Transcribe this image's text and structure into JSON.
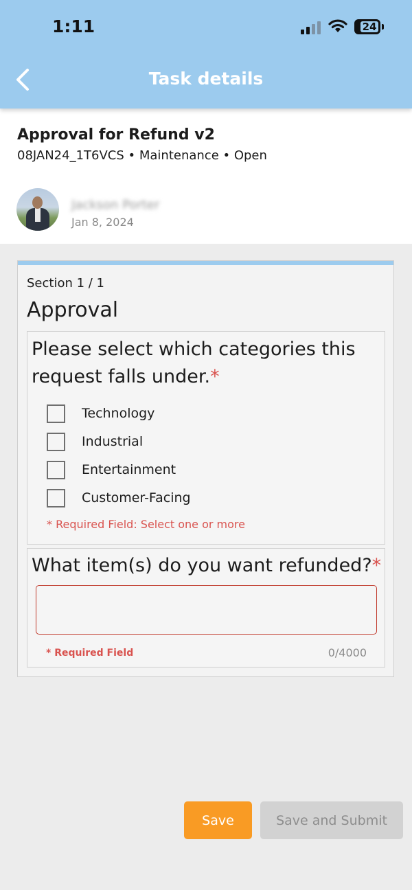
{
  "status_bar": {
    "time": "1:11",
    "battery": "24"
  },
  "nav": {
    "title": "Task details"
  },
  "task": {
    "title": "Approval for Refund v2",
    "meta": "08JAN24_1T6VCS • Maintenance • Open",
    "user_name": "Jackson Porter",
    "date": "Jan 8, 2024"
  },
  "form": {
    "section_label": "Section 1 / 1",
    "section_title": "Approval",
    "q1": {
      "line1": "Please select which categories this",
      "line2": "request falls under.",
      "required_mark": "*",
      "options": [
        "Technology",
        "Industrial",
        "Entertainment",
        "Customer-Facing"
      ],
      "required_note": "* Required Field: Select one or more"
    },
    "q2": {
      "text": "What item(s) do you want refunded?",
      "required_mark": "*",
      "value": "",
      "required_note": "* Required Field",
      "char_count": "0/4000"
    }
  },
  "buttons": {
    "save": "Save",
    "submit": "Save and Submit"
  },
  "colors": {
    "header": "#9ccbee",
    "accent_orange": "#f99b24",
    "required_red": "#d9534f",
    "disabled_gray": "#d2d2d2"
  }
}
